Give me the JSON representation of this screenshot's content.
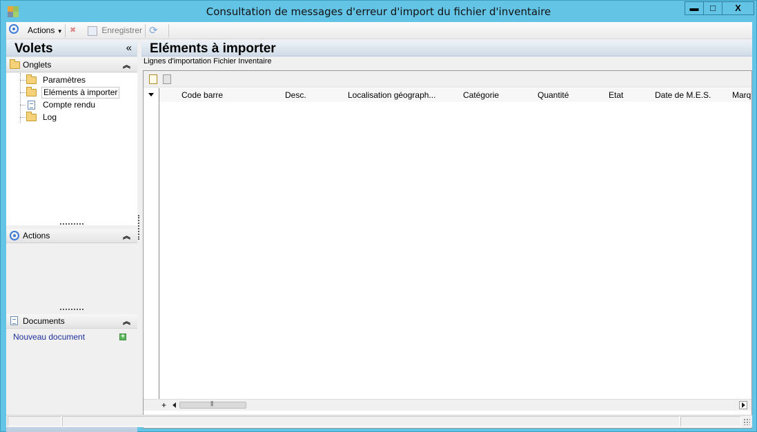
{
  "window": {
    "title": "Consultation de messages d'erreur d'import du fichier d'inventaire",
    "controls": {
      "minimize": "▬",
      "maximize": "□",
      "close": "X"
    }
  },
  "toolbar": {
    "actions_label": "Actions",
    "save_label": "Enregistrer"
  },
  "left_pane": {
    "title": "Volets",
    "collapse_glyph": "«",
    "sections": {
      "onglets": {
        "label": "Onglets",
        "items": [
          {
            "label": "Paramètres",
            "icon": "folder-icon"
          },
          {
            "label": "Eléments à importer",
            "icon": "folder-open-icon",
            "selected": true
          },
          {
            "label": "Compte rendu",
            "icon": "document-icon"
          },
          {
            "label": "Log",
            "icon": "folder-icon"
          }
        ]
      },
      "actions": {
        "label": "Actions"
      },
      "documents": {
        "label": "Documents",
        "new_document": "Nouveau document"
      }
    }
  },
  "main": {
    "title": "Eléments à importer",
    "subtitle": "Lignes d'importation Fichier Inventaire",
    "grid": {
      "columns": [
        "Code barre",
        "Desc.",
        "Localisation géograph...",
        "Catégorie",
        "Quantité",
        "Etat",
        "Date de M.E.S.",
        "Marq"
      ],
      "rows": [],
      "add_row_glyph": "+"
    }
  },
  "status": {
    "cells": [
      "",
      "",
      ""
    ]
  }
}
